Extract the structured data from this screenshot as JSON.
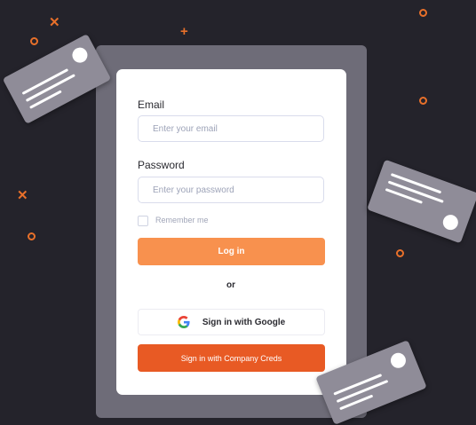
{
  "form": {
    "email_label": "Email",
    "email_placeholder": "Enter your email",
    "email_value": "",
    "password_label": "Password",
    "password_placeholder": "Enter your password",
    "password_value": "",
    "remember_label": "Remember me",
    "remember_checked": false,
    "login_label": "Log in",
    "or_text": "or",
    "google_label": "Sign in with Google",
    "company_label": "Sign in with Company Creds"
  },
  "icons": {
    "google": "google-logo-icon",
    "decor_ring": "ring-icon",
    "decor_plus": "plus-icon",
    "decor_cross": "cross-icon"
  },
  "colors": {
    "background": "#24232b",
    "frame": "#6e6c78",
    "card": "#8f8c98",
    "accent": "#e8702a",
    "login_button": "#f8914e",
    "company_button": "#e85a24"
  }
}
